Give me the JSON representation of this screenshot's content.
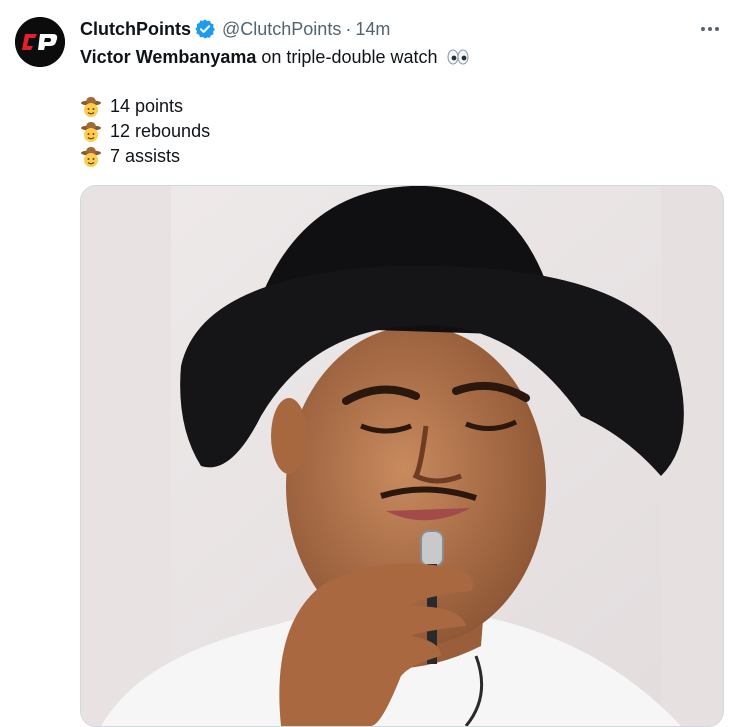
{
  "tweet": {
    "author": {
      "display_name": "ClutchPoints",
      "handle": "@ClutchPoints",
      "avatar_text": "CP",
      "verified": true
    },
    "separator": "·",
    "time": "14m",
    "more_icon": "ellipsis-icon",
    "mention": "Victor Wembanyama",
    "text_rest": " on triple-double watch",
    "text_emoji": "eyes-emoji",
    "stats": [
      {
        "emoji": "cowboy-hat-face-emoji",
        "text": "14 points"
      },
      {
        "emoji": "cowboy-hat-face-emoji",
        "text": "12 rebounds"
      },
      {
        "emoji": "cowboy-hat-face-emoji",
        "text": "7 assists"
      }
    ],
    "media": {
      "kind": "video-still",
      "subject": "man in black cowboy hat holding microphone"
    }
  },
  "colors": {
    "text": "#0f1419",
    "secondary": "#536471",
    "verified_blue": "#1d9bf0",
    "avatar_bg": "#0c0c0c",
    "avatar_red": "#e4202a",
    "media_border": "#cfd9de"
  }
}
